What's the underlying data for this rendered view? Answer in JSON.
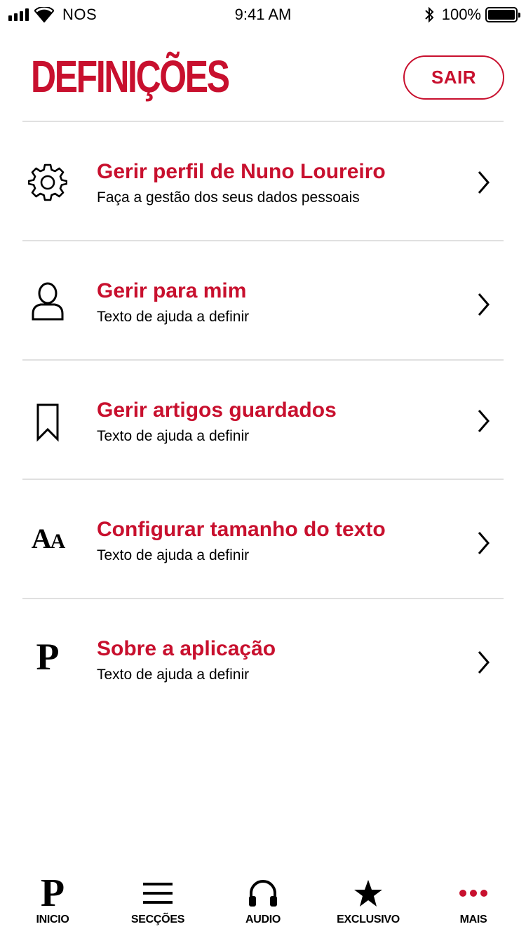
{
  "status_bar": {
    "carrier": "NOS",
    "time": "9:41 AM",
    "battery": "100%"
  },
  "header": {
    "title": "DEFINIÇÕES",
    "logout_label": "SAIR"
  },
  "menu": {
    "items": [
      {
        "icon": "gear-icon",
        "title": "Gerir perfil de Nuno Loureiro",
        "subtitle": "Faça a gestão dos seus dados pessoais"
      },
      {
        "icon": "person-icon",
        "title": "Gerir para mim",
        "subtitle": "Texto de ajuda a definir"
      },
      {
        "icon": "bookmark-icon",
        "title": "Gerir artigos guardados",
        "subtitle": "Texto de ajuda a definir"
      },
      {
        "icon": "text-size-icon",
        "title": "Configurar tamanho do texto",
        "subtitle": "Texto de ajuda a definir",
        "icon_text": "AA"
      },
      {
        "icon": "publico-logo-icon",
        "title": "Sobre a aplicação",
        "subtitle": "Texto de ajuda a definir",
        "icon_text": "P"
      }
    ]
  },
  "tab_bar": {
    "tabs": [
      {
        "label": "INICIO",
        "icon": "publico-logo-icon",
        "icon_text": "P"
      },
      {
        "label": "SECÇÕES",
        "icon": "menu-icon"
      },
      {
        "label": "AUDIO",
        "icon": "headphones-icon"
      },
      {
        "label": "EXCLUSIVO",
        "icon": "star-icon"
      },
      {
        "label": "MAIS",
        "icon": "more-dots-icon",
        "active": true
      }
    ]
  },
  "colors": {
    "accent": "#c8102e",
    "divider": "#e0e0e0",
    "text": "#000000"
  }
}
